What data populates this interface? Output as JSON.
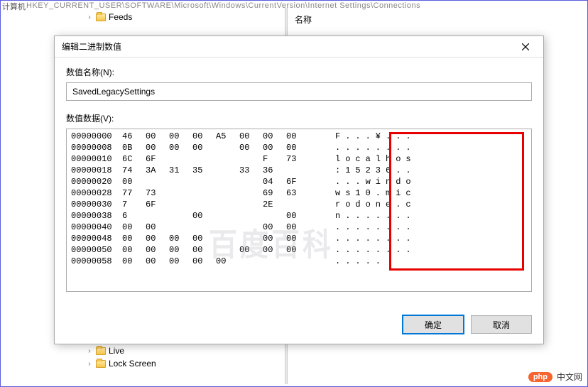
{
  "bg": {
    "left_label": "计算机",
    "path": "HKEY_CURRENT_USER\\SOFTWARE\\Microsoft\\Windows\\CurrentVersion\\Internet Settings\\Connections",
    "tree_items": [
      {
        "caret": "›",
        "label": "Feeds"
      },
      {
        "caret": "›",
        "label": "Live"
      },
      {
        "caret": "›",
        "label": "Lock Screen"
      }
    ],
    "right_header": "名称"
  },
  "dialog": {
    "title": "编辑二进制数值",
    "name_label": "数值名称(N):",
    "data_label": "数值数据(V):",
    "value_name": "SavedLegacySettings",
    "buttons": {
      "ok": "确定",
      "cancel": "取消"
    },
    "hex_rows": [
      {
        "offset": "00000000",
        "bytes": [
          "46",
          "00",
          "00",
          "00",
          "A5",
          "00",
          "00",
          "00"
        ],
        "ascii": "F...¥..."
      },
      {
        "offset": "00000008",
        "bytes": [
          "0B",
          "00",
          "00",
          "00",
          "  ",
          "00",
          "00",
          "00"
        ],
        "ascii": "........"
      },
      {
        "offset": "00000010",
        "bytes": [
          "6C",
          "6F",
          "  ",
          "  ",
          "  ",
          "  ",
          "F ",
          "73"
        ],
        "ascii": "localhos"
      },
      {
        "offset": "00000018",
        "bytes": [
          "74",
          "3A",
          "31",
          "35",
          "  ",
          "33",
          "36",
          "  "
        ],
        "ascii": ":15236.."
      },
      {
        "offset": "00000020",
        "bytes": [
          "00",
          "  ",
          "  ",
          "  ",
          "  ",
          "  ",
          "04",
          "6F"
        ],
        "ascii": "...windo"
      },
      {
        "offset": "00000028",
        "bytes": [
          "77",
          "73",
          "  ",
          "  ",
          "  ",
          "  ",
          "69",
          "63"
        ],
        "ascii": "ws10.mic"
      },
      {
        "offset": "00000030",
        "bytes": [
          "7 ",
          "6F",
          "  ",
          "  ",
          "  ",
          "  ",
          "2E",
          "  "
        ],
        "ascii": "rodone.c"
      },
      {
        "offset": "00000038",
        "bytes": [
          "6 ",
          "  ",
          "  ",
          "00",
          "  ",
          "  ",
          "  ",
          "00"
        ],
        "ascii": "n......."
      },
      {
        "offset": "00000040",
        "bytes": [
          "00",
          "00",
          "  ",
          "  ",
          "  ",
          "  ",
          "00",
          "00"
        ],
        "ascii": "........"
      },
      {
        "offset": "00000048",
        "bytes": [
          "00",
          "00",
          "00",
          "00",
          "  ",
          "  ",
          "00",
          "00"
        ],
        "ascii": "........"
      },
      {
        "offset": "00000050",
        "bytes": [
          "00",
          "00",
          "00",
          "00",
          "  ",
          "00",
          "00",
          "00"
        ],
        "ascii": "........"
      },
      {
        "offset": "00000058",
        "bytes": [
          "00",
          "00",
          "00",
          "00",
          "00"
        ],
        "ascii": "....."
      }
    ]
  },
  "logo": {
    "pill": "php",
    "text": "中文网"
  }
}
